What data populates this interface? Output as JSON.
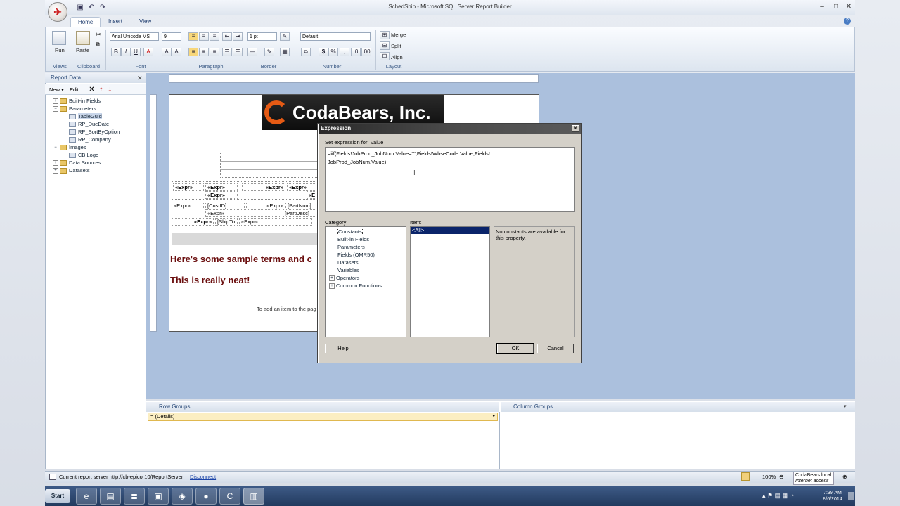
{
  "window": {
    "title": "SchedShip - Microsoft SQL Server Report Builder"
  },
  "ribbon": {
    "tabs": [
      "Home",
      "Insert",
      "View"
    ],
    "run": "Run",
    "paste": "Paste",
    "font_name": "Arial Unicode MS",
    "font_size": "9",
    "border_width": "1 pt",
    "number_format": "Default",
    "merge": "Merge",
    "split": "Split",
    "align": "Align",
    "groups": [
      "Views",
      "Clipboard",
      "Font",
      "Paragraph",
      "Border",
      "Number",
      "Layout"
    ]
  },
  "report_data": {
    "title": "Report Data",
    "new": "New",
    "edit": "Edit...",
    "tree": [
      "Built-in Fields",
      "Parameters",
      "TableGuid",
      "RP_DueDate",
      "RP_SortByOption",
      "RP_Company",
      "Images",
      "CBILogo",
      "Data Sources",
      "Datasets"
    ]
  },
  "canvas": {
    "logo_text": "CodaBears, Inc.",
    "expr": "«Expr»",
    "custid": "[CustID]",
    "partnum": "[PartNum]",
    "partdesc": "[PartDesc]",
    "shipto": "[ShipTo",
    "terms": "Here's some sample terms and c",
    "neat": "This is really neat!",
    "add_item": "To add an item to the pag"
  },
  "dialog": {
    "title": "Expression",
    "set_label": "Set expression for: Value",
    "expression_line1": "=iif(Fields!JobProd_JobNum.Value=\"\",Fields!WhseCode.Value,Fields!",
    "expression_line2": "JobProd_JobNum.Value)",
    "category_label": "Category:",
    "item_label": "Item:",
    "categories": [
      "Constants",
      "Built-in Fields",
      "Parameters",
      "Fields (OMR50)",
      "Datasets",
      "Variables",
      "Operators",
      "Common Functions"
    ],
    "item_selected": "<All>",
    "description": "No constants are available for this property.",
    "help": "Help",
    "ok": "OK",
    "cancel": "Cancel"
  },
  "groups": {
    "row_groups": "Row Groups",
    "column_groups": "Column Groups",
    "details": "= (Details)"
  },
  "status": {
    "server": "Current report server http://cb-epicor10/ReportServer",
    "disconnect": "Disconnect",
    "zoom": "100%",
    "domain": "CodaBears.local",
    "access": "Internet access"
  },
  "taskbar": {
    "start": "Start",
    "time": "7:39 AM",
    "date": "8/6/2014"
  }
}
